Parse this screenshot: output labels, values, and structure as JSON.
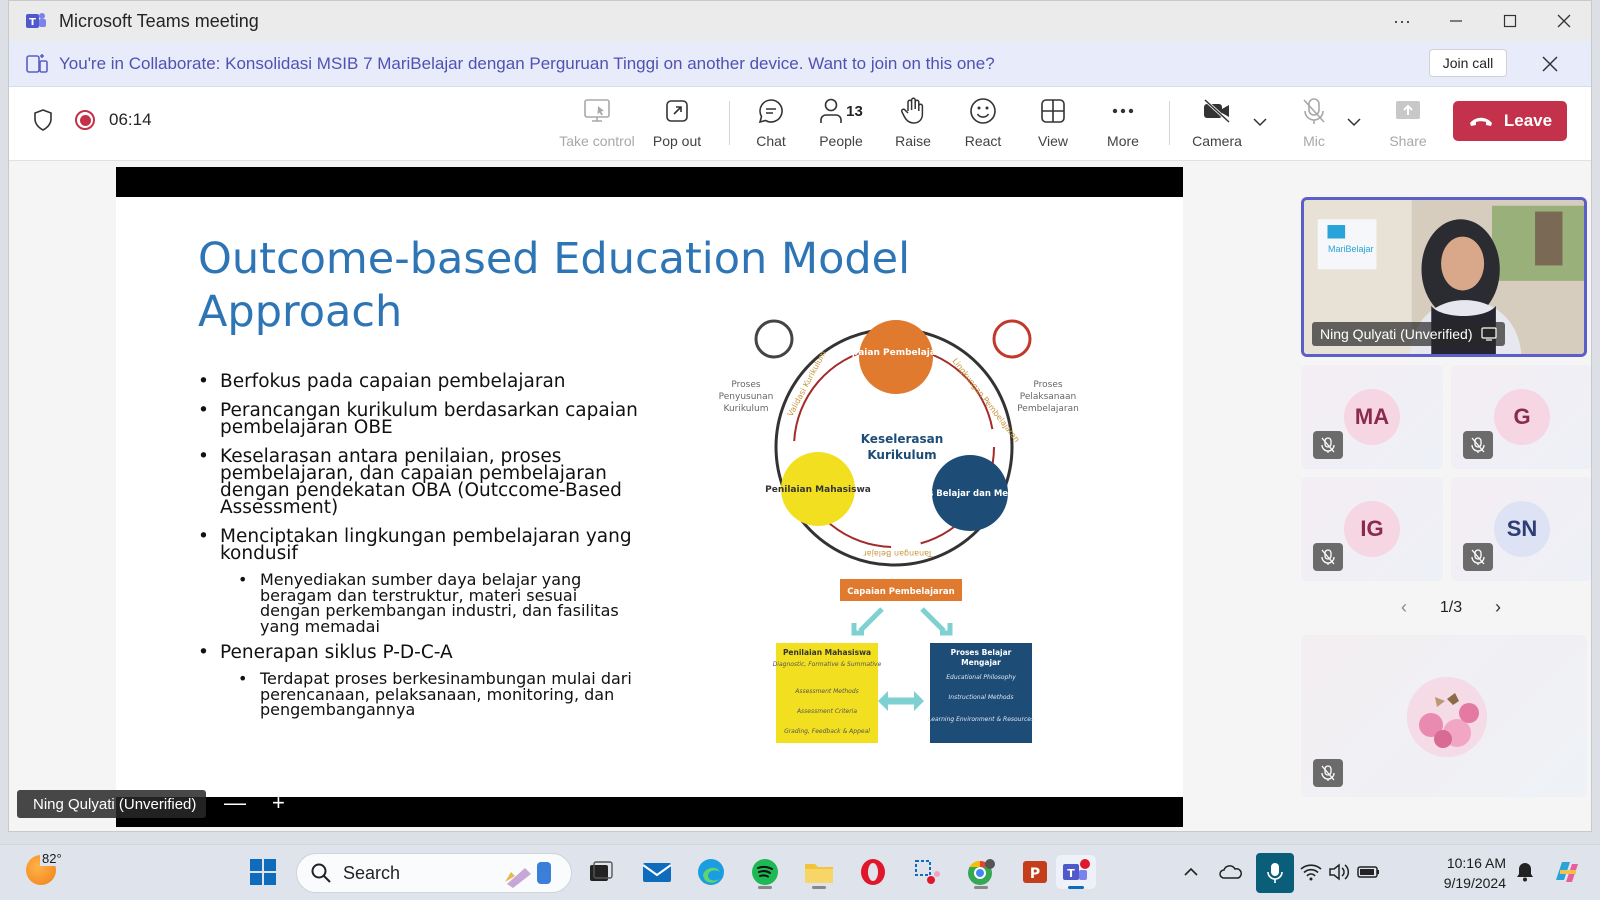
{
  "window": {
    "title": "Microsoft Teams meeting",
    "more_label": "···"
  },
  "banner": {
    "message": "You're in Collaborate: Konsolidasi MSIB 7 MariBelajar dengan Perguruan Tinggi on another device. Want to join on this one?",
    "join_label": "Join call"
  },
  "toolbar": {
    "timer": "06:14",
    "buttons": [
      {
        "label": "Take control",
        "icon": "take-control-icon"
      },
      {
        "label": "Pop out",
        "icon": "pop-out-icon"
      },
      {
        "label": "Chat",
        "icon": "chat-icon"
      },
      {
        "label": "People",
        "icon": "people-icon",
        "count": "13"
      },
      {
        "label": "Raise",
        "icon": "hand-icon"
      },
      {
        "label": "React",
        "icon": "smile-icon"
      },
      {
        "label": "View",
        "icon": "grid-icon"
      },
      {
        "label": "More",
        "icon": "more-icon"
      },
      {
        "label": "Camera",
        "icon": "camera-off-icon"
      },
      {
        "label": "Mic",
        "icon": "mic-off-icon"
      },
      {
        "label": "Share",
        "icon": "share-icon"
      }
    ],
    "leave_label": "Leave"
  },
  "slide": {
    "title_line1": "Outcome-based Education Model",
    "title_line2": "Approach",
    "bullets": [
      "Berfokus pada capaian pembelajaran",
      "Perancangan kurikulum berdasarkan capaian pembelajaran OBE",
      "Keselarasan antara penilaian, proses pembelajaran, dan capaian pembelajaran dengan pendekatan OBA (Outccome-Based Assessment)",
      "Menciptakan lingkungan pembelajaran yang kondusif",
      "Penerapan siklus P-D-C-A"
    ],
    "sub_bullets": [
      "Menyediakan sumber daya belajar yang beragam dan terstruktur, materi sesuai dengan perkembangan industri, dan fasilitas yang memadai",
      "Terdapat proses berkesinambungan mulai dari perencanaan, pelaksanaan, monitoring, dan pengembangannya"
    ],
    "diagram": {
      "capaian": "Capaian Pembelajaran",
      "penilaian": "Penilaian Mahasiswa",
      "proses": "Proses Belajar dan Mengajar",
      "center_1": "Keselerasan",
      "center_2": "Kurikulum",
      "left_label_1": "Proses",
      "left_label_2": "Penyusunan",
      "left_label_3": "Kurikulum",
      "right_label_1": "Proses",
      "right_label_2": "Pelaksanaan",
      "right_label_3": "Pembelajaran",
      "arc_left": "Validasi Kurikulum",
      "arc_right": "Lingkungan Pembelajaran",
      "arc_bottom": "Tanangan Belajar",
      "box_top": "Capaian Pembelajaran",
      "box_left_title_1": "Penilaian Mahasiswa",
      "box_left_sub": "Diagnostic, Formative & Summative",
      "box_left_2": "Assessment Methods",
      "box_left_3": "Assessment Criteria",
      "box_left_4": "Grading, Feedback & Appeal",
      "box_right_title_1": "Proses Belajar",
      "box_right_title_2": "Mengajar",
      "box_right_2": "Educational Philosophy",
      "box_right_3": "Instructional Methods",
      "box_right_4": "Learning Environment & Resources"
    }
  },
  "stage": {
    "presenter_name": "Ning Qulyati (Unverified)",
    "zoom_out": "—",
    "zoom_in": "+"
  },
  "gallery": {
    "main_name": "Ning Qulyati (Unverified)",
    "main_logo_text": "MariBelajar",
    "participants": [
      {
        "initials": "MA",
        "color": "#f6d6e3"
      },
      {
        "initials": "G",
        "color": "#f6d6e3"
      },
      {
        "initials": "IG",
        "color": "#f6d6e3"
      },
      {
        "initials": "SN",
        "color": "#dde3f4"
      }
    ],
    "page": "1/3"
  },
  "taskbar": {
    "temperature": "82°",
    "search_placeholder": "Search",
    "time": "10:16 AM",
    "date": "9/19/2024"
  }
}
